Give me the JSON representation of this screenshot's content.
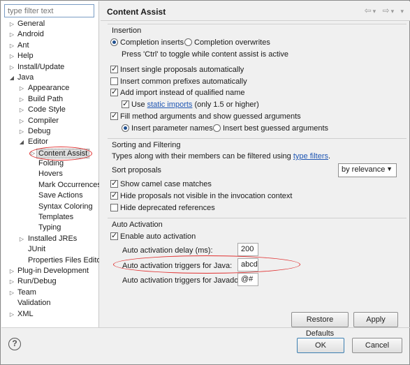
{
  "filter": {
    "placeholder": "type filter text"
  },
  "tree": [
    {
      "label": "General",
      "level": 0,
      "arrow": "▷"
    },
    {
      "label": "Android",
      "level": 0,
      "arrow": "▷"
    },
    {
      "label": "Ant",
      "level": 0,
      "arrow": "▷"
    },
    {
      "label": "Help",
      "level": 0,
      "arrow": "▷"
    },
    {
      "label": "Install/Update",
      "level": 0,
      "arrow": "▷"
    },
    {
      "label": "Java",
      "level": 0,
      "arrow": "◢"
    },
    {
      "label": "Appearance",
      "level": 1,
      "arrow": "▷"
    },
    {
      "label": "Build Path",
      "level": 1,
      "arrow": "▷"
    },
    {
      "label": "Code Style",
      "level": 1,
      "arrow": "▷"
    },
    {
      "label": "Compiler",
      "level": 1,
      "arrow": "▷"
    },
    {
      "label": "Debug",
      "level": 1,
      "arrow": "▷"
    },
    {
      "label": "Editor",
      "level": 1,
      "arrow": "◢"
    },
    {
      "label": "Content Assist",
      "level": 2,
      "arrow": "▷",
      "selected": true
    },
    {
      "label": "Folding",
      "level": 2,
      "arrow": ""
    },
    {
      "label": "Hovers",
      "level": 2,
      "arrow": ""
    },
    {
      "label": "Mark Occurrences",
      "level": 2,
      "arrow": ""
    },
    {
      "label": "Save Actions",
      "level": 2,
      "arrow": ""
    },
    {
      "label": "Syntax Coloring",
      "level": 2,
      "arrow": ""
    },
    {
      "label": "Templates",
      "level": 2,
      "arrow": ""
    },
    {
      "label": "Typing",
      "level": 2,
      "arrow": ""
    },
    {
      "label": "Installed JREs",
      "level": 1,
      "arrow": "▷"
    },
    {
      "label": "JUnit",
      "level": 1,
      "arrow": ""
    },
    {
      "label": "Properties Files Edito",
      "level": 1,
      "arrow": ""
    },
    {
      "label": "Plug-in Development",
      "level": 0,
      "arrow": "▷"
    },
    {
      "label": "Run/Debug",
      "level": 0,
      "arrow": "▷"
    },
    {
      "label": "Team",
      "level": 0,
      "arrow": "▷"
    },
    {
      "label": "Validation",
      "level": 0,
      "arrow": ""
    },
    {
      "label": "XML",
      "level": 0,
      "arrow": "▷"
    }
  ],
  "header": {
    "title": "Content Assist",
    "back": "⇦",
    "back_menu": "▾",
    "forward": "⇨",
    "forward_menu": "▾",
    "menu": "▾"
  },
  "insertion": {
    "title": "Insertion",
    "completion_inserts": "Completion inserts",
    "completion_overwrites": "Completion overwrites",
    "toggle_hint": "Press 'Ctrl' to toggle while content assist is active",
    "insert_single": "Insert single proposals automatically",
    "insert_common": "Insert common prefixes automatically",
    "add_import": "Add import instead of qualified name",
    "use_prefix": "Use",
    "static_imports": "static imports",
    "use_suffix": "(only 1.5 or higher)",
    "fill_args": "Fill method arguments and show guessed arguments",
    "insert_param_names": "Insert parameter names",
    "insert_best_guessed": "Insert best guessed arguments"
  },
  "sorting": {
    "title": "Sorting and Filtering",
    "desc_prefix": "Types along with their members can be filtered using",
    "type_filters": "type filters",
    "desc_suffix": ".",
    "sort_label": "Sort proposals",
    "sort_value": "by relevance",
    "camel_case": "Show camel case matches",
    "hide_not_visible": "Hide proposals not visible in the invocation context",
    "hide_deprecated": "Hide deprecated references"
  },
  "auto": {
    "title": "Auto Activation",
    "enable": "Enable auto activation",
    "delay_label": "Auto activation delay (ms):",
    "delay_value": "200",
    "java_label": "Auto activation triggers for Java:",
    "java_value": "abcdefghijklmnopqrstuvwxyz.",
    "javadoc_label": "Auto activation triggers for Javadoc:",
    "javadoc_value": "@#"
  },
  "buttons": {
    "restore": "Restore Defaults",
    "apply": "Apply",
    "ok": "OK",
    "cancel": "Cancel",
    "help": "?"
  },
  "state": {
    "completion_inserts": true,
    "insert_single": true,
    "insert_common": false,
    "add_import": true,
    "use_static_imports": true,
    "fill_args": true,
    "insert_param_names": true,
    "camel_case": true,
    "hide_not_visible": true,
    "hide_deprecated": false,
    "enable_auto": true
  },
  "colors": {
    "link": "#1f56b3",
    "annotation": "#e03030"
  }
}
